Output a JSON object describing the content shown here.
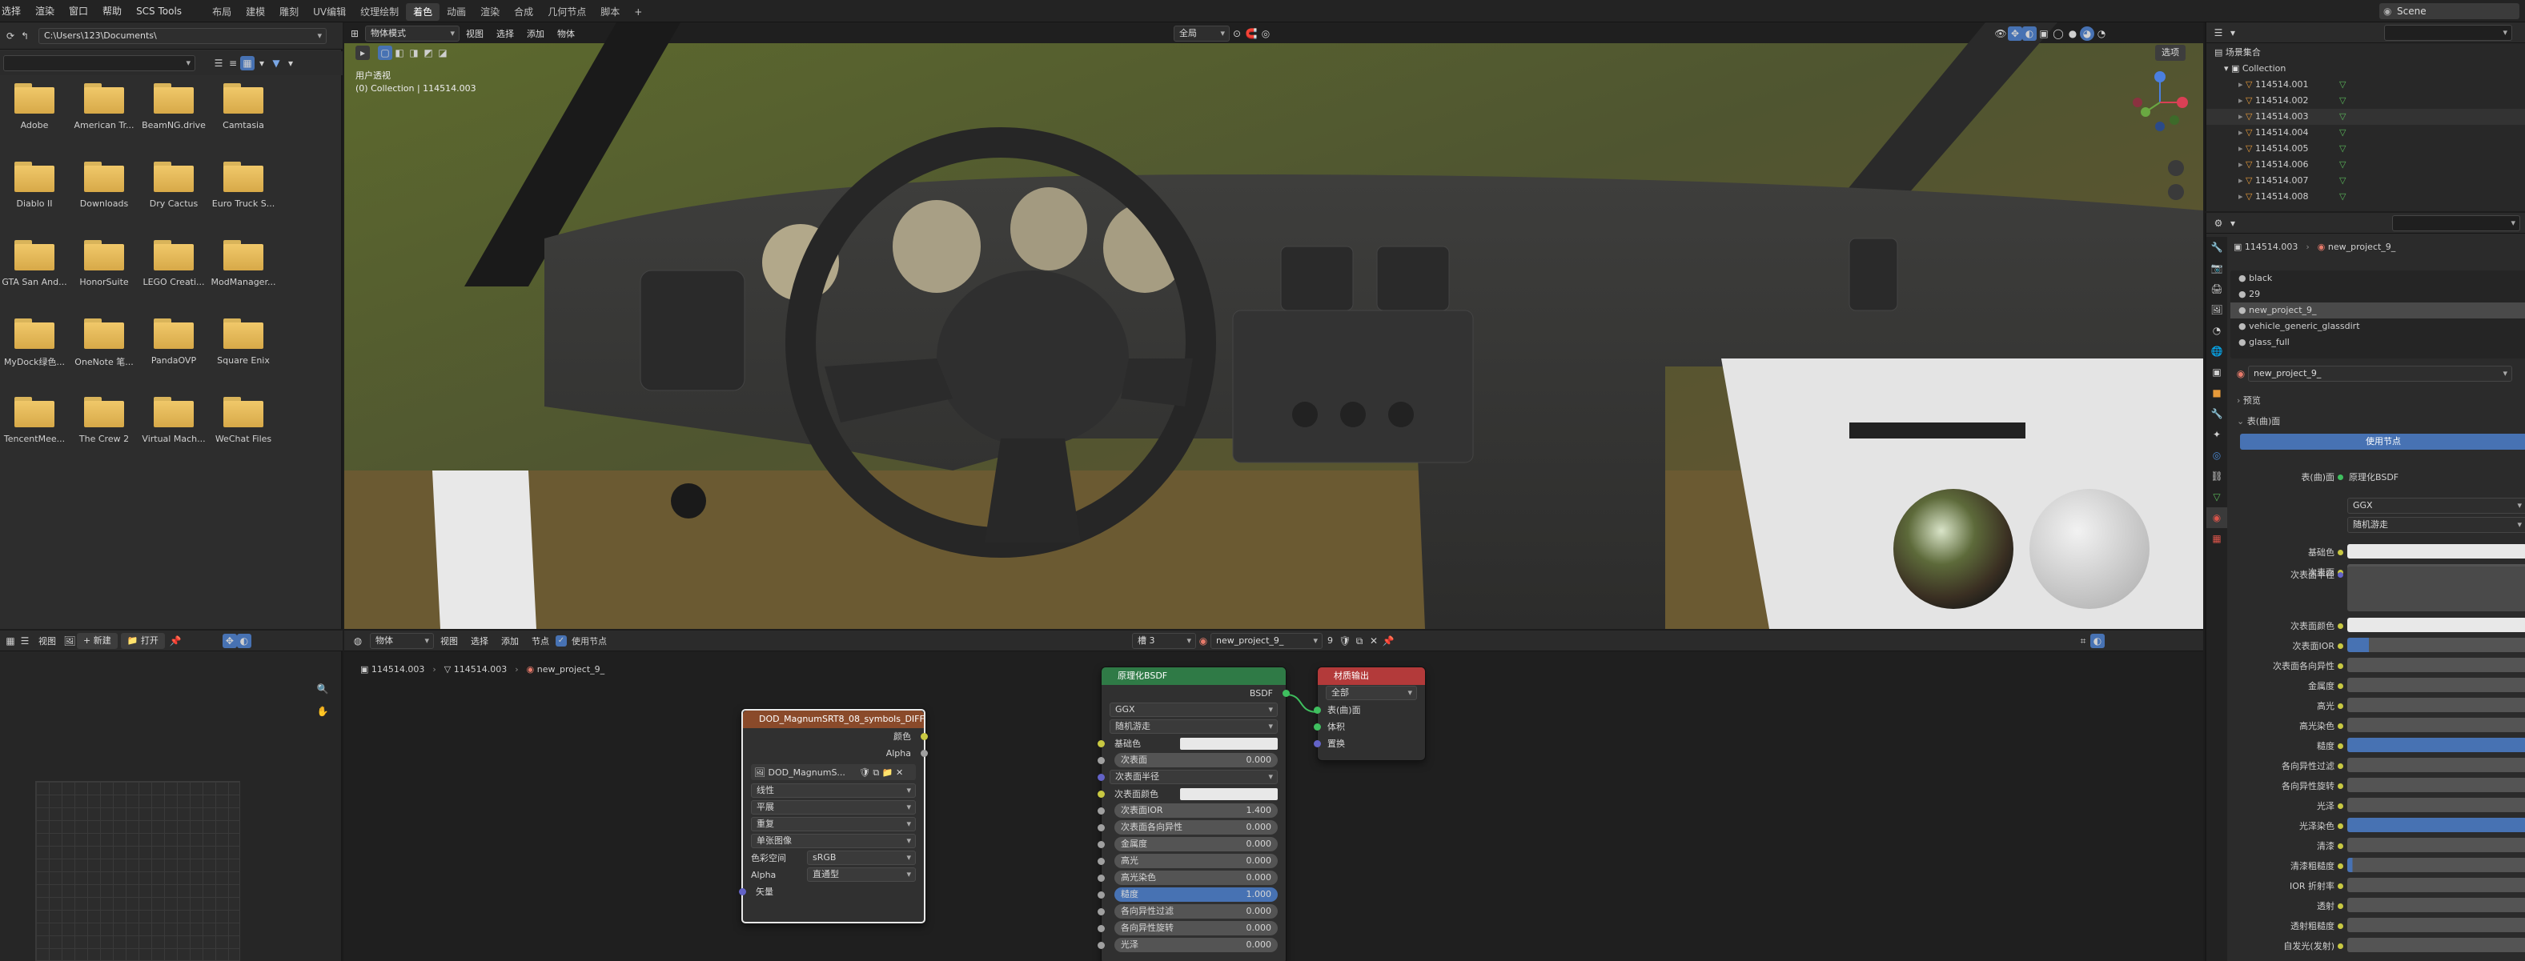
{
  "menubar": {
    "menus": [
      "选择",
      "渲染",
      "窗口",
      "帮助",
      "SCS Tools"
    ],
    "workspaces": [
      "布局",
      "建模",
      "雕刻",
      "UV编辑",
      "纹理绘制",
      "着色",
      "动画",
      "渲染",
      "合成",
      "几何节点",
      "脚本"
    ],
    "active_workspace": "着色",
    "add_tab": "+",
    "scene": "Scene"
  },
  "filebrowser": {
    "path": "C:\\Users\\123\\Documents\\",
    "folders": [
      "Adobe",
      "American Tr...",
      "BeamNG.drive",
      "Camtasia",
      "Diablo II",
      "Downloads",
      "Dry Cactus",
      "Euro Truck S...",
      "GTA San And...",
      "HonorSuite",
      "LEGO Creati...",
      "ModManager...",
      "MyDock绿色...",
      "OneNote 笔...",
      "PandaOVP",
      "Square Enix",
      "TencentMee...",
      "The Crew 2",
      "Virtual Mach...",
      "WeChat Files"
    ]
  },
  "viewport": {
    "mode": "物体模式",
    "menus": [
      "视图",
      "选择",
      "添加",
      "物体"
    ],
    "transform": "全局",
    "view_label": "用户透视",
    "collection_label": "(0) Collection | 114514.003",
    "options": "选项"
  },
  "outliner": {
    "title": "场景集合",
    "collection": "Collection",
    "objects": [
      "114514.001",
      "114514.002",
      "114514.003",
      "114514.004",
      "114514.005",
      "114514.006",
      "114514.007",
      "114514.008"
    ]
  },
  "properties": {
    "object": "114514.003",
    "material": "new_project_9_",
    "slots": [
      "black",
      "29",
      "new_project_9_",
      "vehicle_generic_glassdirt",
      "glass_full"
    ],
    "active_slot": "new_project_9_",
    "material_field": "new_project_9_",
    "preview": "预览",
    "surface": "表(曲)面",
    "use_nodes": "使用节点",
    "surface_shader": "原理化BSDF",
    "distribution": "GGX",
    "subsurface_method": "随机游走",
    "rows": [
      "基础色",
      "次表面",
      "次表面半径",
      "次表面颜色",
      "次表面IOR",
      "次表面各向异性",
      "金属度",
      "高光",
      "高光染色",
      "糙度",
      "各向异性过滤",
      "各向异性旋转",
      "光泽",
      "光泽染色",
      "清漆",
      "清漆粗糙度",
      "IOR 折射率",
      "透射",
      "透射粗糙度",
      "自发光(发射)"
    ]
  },
  "imgeditor": {
    "menus": [
      "视图"
    ],
    "new": "新建",
    "open": "打开"
  },
  "nodeeditor": {
    "mode": "物体",
    "menus": [
      "视图",
      "选择",
      "添加",
      "节点"
    ],
    "use_nodes": "使用节点",
    "slot": "槽 3",
    "material": "new_project_9_",
    "users": "9",
    "breadcrumb": [
      "114514.003",
      "114514.003",
      "new_project_9_"
    ],
    "image_node": {
      "title": "DOD_MagnumSRT8_08_symbols_DIFF...",
      "outputs": [
        "颜色",
        "Alpha"
      ],
      "image": "DOD_MagnumS...",
      "interpolation": "线性",
      "projection": "平展",
      "extension": "重复",
      "source": "单张图像",
      "colorspace_label": "色彩空间",
      "colorspace": "sRGB",
      "alpha_label": "Alpha",
      "alpha": "直通型",
      "vector": "矢量"
    },
    "bsdf_node": {
      "title": "原理化BSDF",
      "output": "BSDF",
      "distribution": "GGX",
      "method": "随机游走",
      "inputs": [
        {
          "name": "基础色",
          "value": ""
        },
        {
          "name": "次表面",
          "value": "0.000"
        },
        {
          "name": "次表面半径",
          "value": ""
        },
        {
          "name": "次表面颜色",
          "value": ""
        },
        {
          "name": "次表面IOR",
          "value": "1.400"
        },
        {
          "name": "次表面各向异性",
          "value": "0.000"
        },
        {
          "name": "金属度",
          "value": "0.000"
        },
        {
          "name": "高光",
          "value": "0.000"
        },
        {
          "name": "高光染色",
          "value": "0.000"
        },
        {
          "name": "糙度",
          "value": "1.000"
        },
        {
          "name": "各向异性过滤",
          "value": "0.000"
        },
        {
          "name": "各向异性旋转",
          "value": "0.000"
        },
        {
          "name": "光泽",
          "value": "0.000"
        }
      ]
    },
    "output_node": {
      "title": "材质输出",
      "target": "全部",
      "inputs": [
        "表(曲)面",
        "体积",
        "置换"
      ]
    }
  },
  "colors": {
    "accent": "#4772b3",
    "image_node_header": "#8a4a2a",
    "bsdf_node_header": "#2f7a46",
    "output_node_header": "#b33a3a"
  }
}
